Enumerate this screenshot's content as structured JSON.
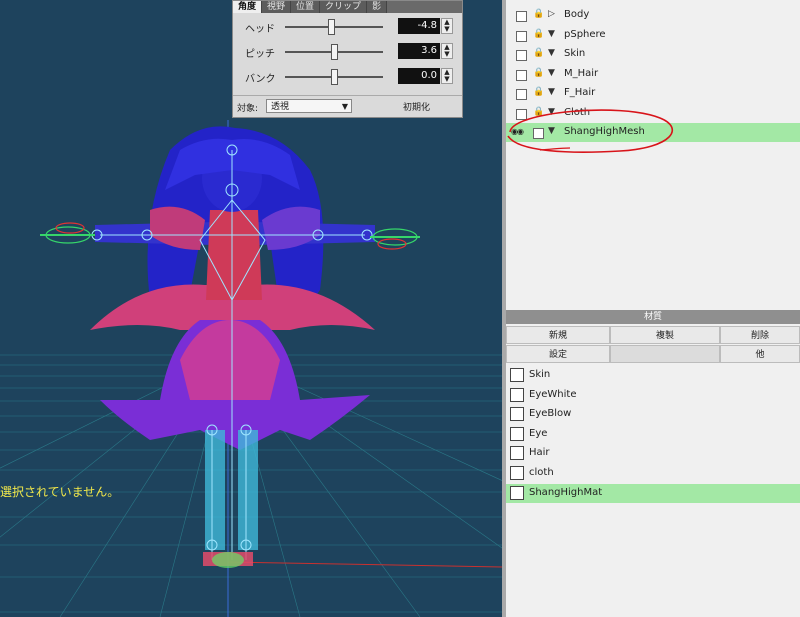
{
  "viewport": {
    "message": "選択されていません。"
  },
  "camera": {
    "tabs": [
      "角度",
      "視野",
      "位置",
      "クリップ",
      "影"
    ],
    "params": [
      {
        "label": "ヘッド",
        "value": "-4.8",
        "level": 0.47
      },
      {
        "label": "ピッチ",
        "value": "3.6",
        "level": 0.5
      },
      {
        "label": "バンク",
        "value": "0.0",
        "level": 0.5
      }
    ],
    "target_label": "対象:",
    "target_value": "透視",
    "reset_label": "初期化"
  },
  "objects": [
    {
      "name": "Body",
      "expanded": false
    },
    {
      "name": "pSphere",
      "expanded": true
    },
    {
      "name": "Skin",
      "expanded": true
    },
    {
      "name": "M_Hair",
      "expanded": true
    },
    {
      "name": "F_Hair",
      "expanded": true
    },
    {
      "name": "Cloth",
      "expanded": true
    },
    {
      "name": "ShangHighMesh",
      "expanded": true,
      "selected": true
    }
  ],
  "materials": {
    "header": "材質",
    "buttons": {
      "new": "新規",
      "copy": "複製",
      "delete": "削除",
      "settings": "設定",
      "other": "他"
    },
    "items": [
      {
        "name": "Skin"
      },
      {
        "name": "EyeWhite"
      },
      {
        "name": "EyeBlow"
      },
      {
        "name": "Eye"
      },
      {
        "name": "Hair"
      },
      {
        "name": "cloth"
      },
      {
        "name": "ShangHighMat",
        "selected": true
      }
    ]
  },
  "colors": {
    "viewport_bg": "#1e435d",
    "selection_green": "#a3e8a5",
    "annotation_red": "#d8141a",
    "message_yellow": "#f2e84a"
  }
}
